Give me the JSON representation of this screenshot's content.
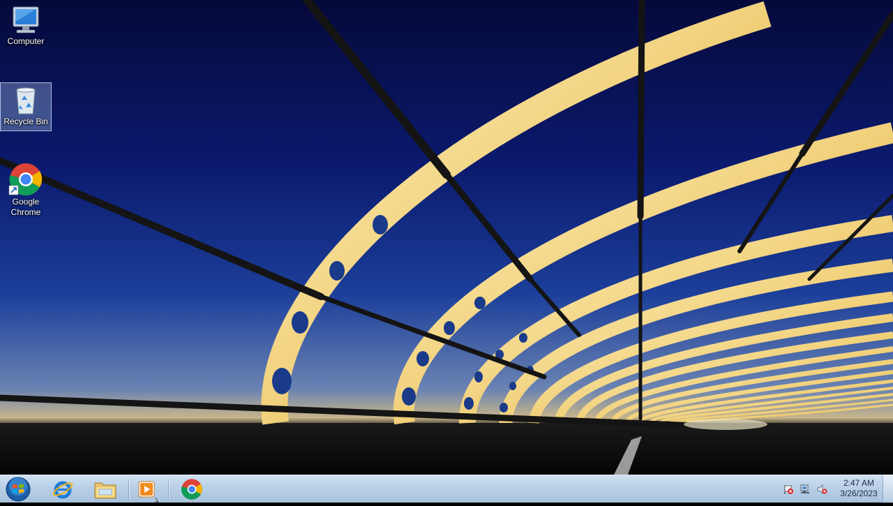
{
  "desktop": {
    "icons": [
      {
        "label": "Computer",
        "icon": "computer-icon"
      },
      {
        "label": "Recycle Bin",
        "icon": "recycle-bin-icon",
        "selected": true
      },
      {
        "label": "Google\nChrome",
        "icon": "chrome-icon",
        "line1": "Google",
        "line2": "Chrome"
      }
    ]
  },
  "taskbar": {
    "start": {
      "icon": "windows-start-orb-icon"
    },
    "pinned": [
      {
        "name": "Internet Explorer",
        "icon": "internet-explorer-icon"
      },
      {
        "name": "Windows Explorer",
        "icon": "file-explorer-folder-icon"
      },
      {
        "name": "Windows Media Player",
        "icon": "media-player-icon"
      },
      {
        "name": "Google Chrome",
        "icon": "chrome-icon"
      }
    ],
    "tray": {
      "icons": [
        "action-center-flag-icon",
        "network-icon",
        "volume-muted-icon"
      ],
      "time": "2:47 AM",
      "date": "3/26/2023"
    }
  },
  "colors": {
    "sky_top": "#05093a",
    "sky_mid": "#1c3f9a",
    "bridge_gold": "#f3d98a",
    "taskbar": "#b9d0e8"
  }
}
